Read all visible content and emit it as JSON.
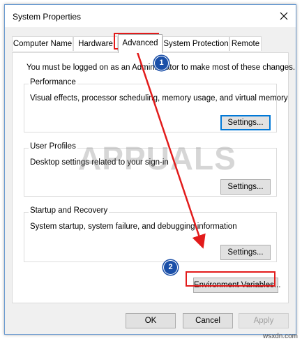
{
  "window": {
    "title": "System Properties"
  },
  "tabs": [
    {
      "label": "Computer Name"
    },
    {
      "label": "Hardware"
    },
    {
      "label": "Advanced"
    },
    {
      "label": "System Protection"
    },
    {
      "label": "Remote"
    }
  ],
  "admin_note": "You must be logged on as an Administrator to make most of these changes.",
  "performance": {
    "title": "Performance",
    "description": "Visual effects, processor scheduling, memory usage, and virtual memory",
    "button": "Settings..."
  },
  "user_profiles": {
    "title": "User Profiles",
    "description": "Desktop settings related to your sign-in",
    "button": "Settings..."
  },
  "startup_recovery": {
    "title": "Startup and Recovery",
    "description": "System startup, system failure, and debugging information",
    "button": "Settings..."
  },
  "env_button": "Environment Variables...",
  "footer": {
    "ok": "OK",
    "cancel": "Cancel",
    "apply": "Apply"
  },
  "annotations": {
    "step1": "1",
    "step2": "2",
    "highlight_color": "#e21b1b",
    "badge_color": "#1a4fa8"
  },
  "watermark": {
    "logo": "APPUALS",
    "site": "wsxdn.com"
  }
}
